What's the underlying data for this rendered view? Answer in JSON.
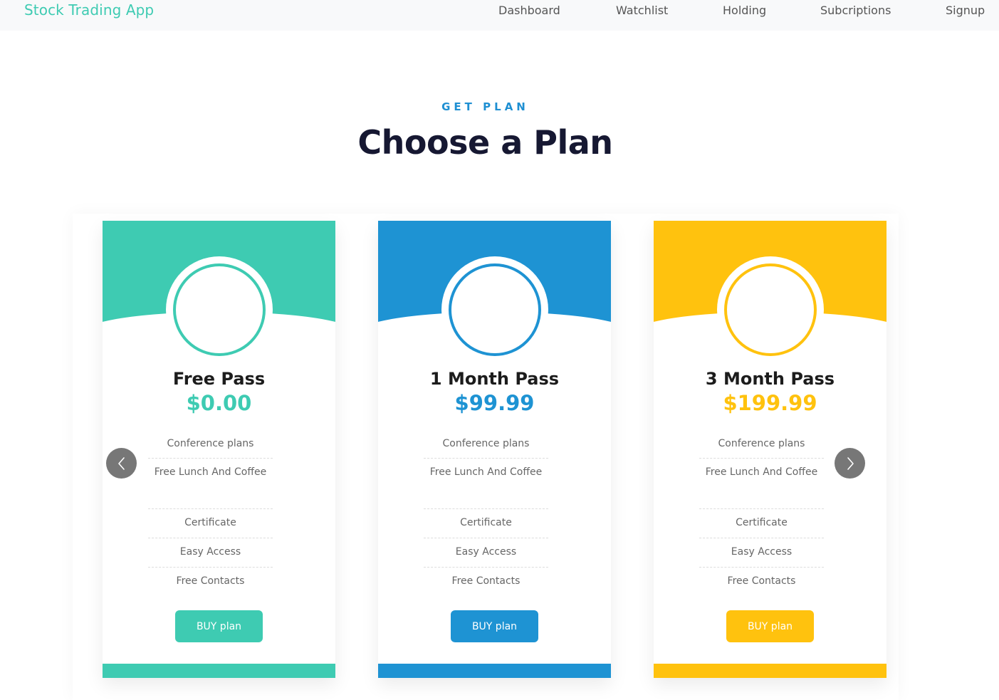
{
  "navbar": {
    "brand": "Stock Trading App",
    "links": [
      "Dashboard",
      "Watchlist",
      "Holding",
      "Subcriptions",
      "Signup"
    ]
  },
  "header": {
    "eyebrow": "GET PLAN",
    "title": "Choose a Plan"
  },
  "plans": [
    {
      "name": "Free Pass",
      "price": "$0.00",
      "color": "#3ecbb2",
      "features": [
        "Conference plans",
        "Free Lunch And Coffee",
        "Certificate",
        "Easy Access",
        "Free Contacts"
      ],
      "button_label": "BUY plan"
    },
    {
      "name": "1 Month Pass",
      "price": "$99.99",
      "color": "#1e93d3",
      "features": [
        "Conference plans",
        "Free Lunch And Coffee",
        "Certificate",
        "Easy Access",
        "Free Contacts"
      ],
      "button_label": "BUY plan"
    },
    {
      "name": "3 Month Pass",
      "price": "$199.99",
      "color": "#ffc20e",
      "features": [
        "Conference plans",
        "Free Lunch And Coffee",
        "Certificate",
        "Easy Access",
        "Free Contacts"
      ],
      "button_label": "BUY plan"
    }
  ],
  "carousel": {
    "prev_icon": "chevron-left-icon",
    "next_icon": "chevron-right-icon"
  }
}
